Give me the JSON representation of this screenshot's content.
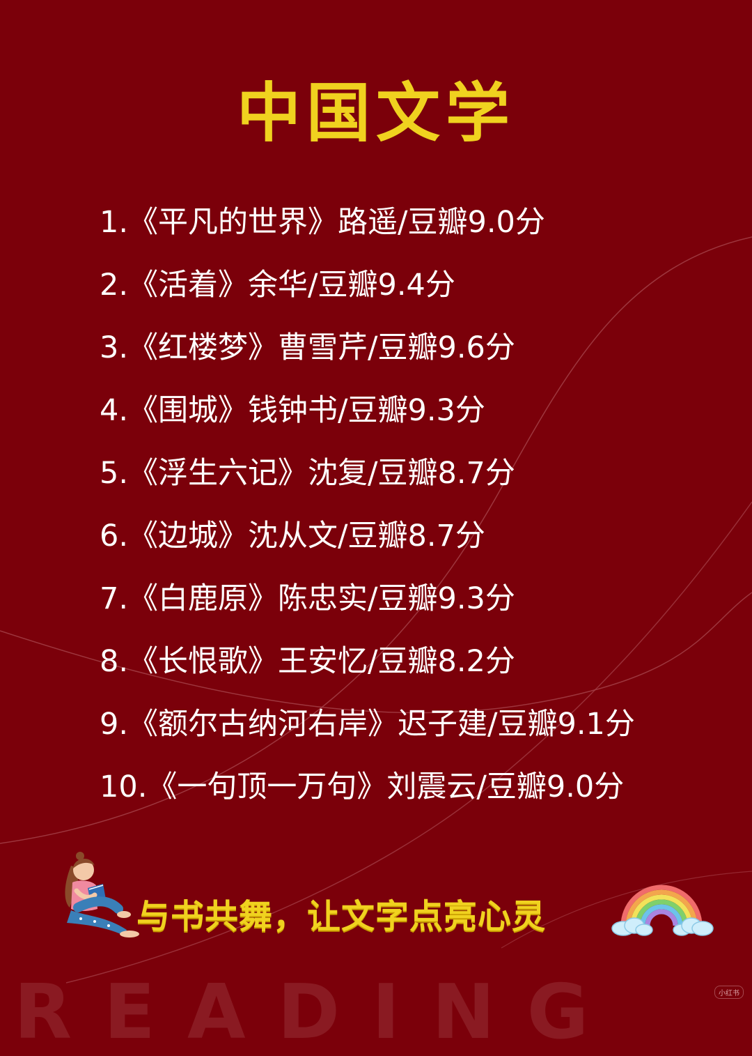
{
  "title": "中国文学",
  "books": [
    "1.《平凡的世界》路遥/豆瓣9.0分",
    "2.《活着》余华/豆瓣9.4分",
    "3.《红楼梦》曹雪芹/豆瓣9.6分",
    "4.《围城》钱钟书/豆瓣9.3分",
    "5.《浮生六记》沈复/豆瓣8.7分",
    "6.《边城》沈从文/豆瓣8.7分",
    "7.《白鹿原》陈忠实/豆瓣9.3分",
    "8.《长恨歌》王安忆/豆瓣8.2分",
    "9.《额尔古纳河右岸》迟子建/豆瓣9.1分",
    "10.《一句顶一万句》刘震云/豆瓣9.0分"
  ],
  "slogan": "与书共舞，让文字点亮心灵",
  "watermark": "READING",
  "badge": "小红书",
  "colors": {
    "background": "#7b000a",
    "accent": "#f0d21f",
    "text": "#ffffff"
  },
  "icons": {
    "reader": "girl-reading-book-illustration",
    "rainbow": "rainbow-with-clouds-illustration"
  }
}
